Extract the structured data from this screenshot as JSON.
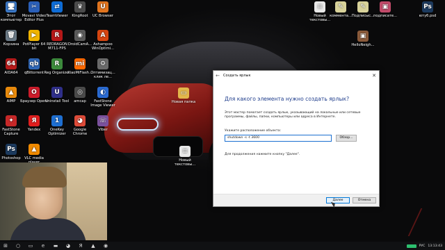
{
  "desktop": {
    "icons_left": [
      {
        "label": "Этот компьютер",
        "glyph": "🖥",
        "color": "#3a78c8",
        "icon": "computer-icon"
      },
      {
        "label": "Movavi Video Editor Plus",
        "glyph": "✂",
        "color": "#2a5fb8",
        "icon": "movavi-icon"
      },
      {
        "label": "TeamViewer",
        "glyph": "⇄",
        "color": "#0e6cd6",
        "icon": "teamviewer-icon"
      },
      {
        "label": "KingRoot",
        "glyph": "♛",
        "color": "#4b4b4b",
        "icon": "kingroot-icon"
      },
      {
        "label": "UC Browser",
        "glyph": "U",
        "color": "#e0741e",
        "icon": "uc-browser-icon"
      },
      {
        "label": "Корзина",
        "glyph": "🗑",
        "color": "#6b7a86",
        "icon": "recycle-bin-icon"
      },
      {
        "label": "PotPlayer 64 bit",
        "glyph": "▶",
        "color": "#f0b400",
        "icon": "potplayer-icon"
      },
      {
        "label": "REDRAGON M711-FPS",
        "glyph": "R",
        "color": "#b51818",
        "icon": "redragon-icon"
      },
      {
        "label": "DroidCamA...",
        "glyph": "◉",
        "color": "#5a5a5a",
        "icon": "droidcam-icon"
      },
      {
        "label": "Ashampoo WinOptimi...",
        "glyph": "A",
        "color": "#d64510",
        "icon": "ashampoo-icon"
      },
      {
        "label": "AIDA64",
        "glyph": "64",
        "color": "#b71b1b",
        "icon": "aida64-icon"
      },
      {
        "label": "qBittorrent",
        "glyph": "qb",
        "color": "#2f67b6",
        "icon": "qbittorrent-icon"
      },
      {
        "label": "Reg Organizer",
        "glyph": "R",
        "color": "#3c8a3c",
        "icon": "reg-organizer-icon"
      },
      {
        "label": "XiaoMiFlash...",
        "glyph": "mi",
        "color": "#ff6900",
        "icon": "xiaomi-flash-icon"
      },
      {
        "label": "Оптимизац... клик ле...",
        "glyph": "⚙",
        "color": "#6a6a6a",
        "icon": "optimizer-icon"
      },
      {
        "label": "AIMP",
        "glyph": "▲",
        "color": "#e88a0c",
        "icon": "aimp-icon"
      },
      {
        "label": "Браузер Opera",
        "glyph": "O",
        "color": "#cc1b2a",
        "icon": "opera-icon"
      },
      {
        "label": "Uninstall Tool",
        "glyph": "U",
        "color": "#2f2f8a",
        "icon": "uninstall-tool-icon"
      },
      {
        "label": "amcap",
        "glyph": "◎",
        "color": "#4a4a4a",
        "icon": "amcap-icon"
      },
      {
        "label": "FastStone Image Viewer",
        "glyph": "◐",
        "color": "#2a6ad0",
        "icon": "faststone-viewer-icon"
      },
      {
        "label": "FastStone Capture",
        "glyph": "✦",
        "color": "#c62828",
        "icon": "faststone-capture-icon"
      },
      {
        "label": "Yandex",
        "glyph": "Я",
        "color": "#e01e1e",
        "icon": "yandex-icon"
      },
      {
        "label": "OneKey Optimizer",
        "glyph": "1",
        "color": "#1e6fd1",
        "icon": "onekey-icon"
      },
      {
        "label": "Google Chrome",
        "glyph": "◕",
        "color": "#dd4b39",
        "icon": "chrome-icon"
      },
      {
        "label": "Viber",
        "glyph": "☏",
        "color": "#7b519d",
        "icon": "viber-icon"
      },
      {
        "label": "Photoshop",
        "glyph": "Ps",
        "color": "#1c3a5e",
        "icon": "photoshop-icon"
      },
      {
        "label": "VLC media player",
        "glyph": "▲",
        "color": "#f08a00",
        "icon": "vlc-icon"
      }
    ],
    "icons_right": [
      {
        "label": "Новый текстовы...",
        "glyph": "≡",
        "color": "#e8e8e8",
        "icon": "text-file-icon"
      },
      {
        "label": "коммента...",
        "glyph": "✎",
        "color": "#d8d29a",
        "icon": "document-icon"
      },
      {
        "label": "Подписыс...",
        "glyph": "✎",
        "color": "#d8d29a",
        "icon": "document-icon"
      },
      {
        "label": "подписате...",
        "glyph": "▣",
        "color": "#c24b6a",
        "icon": "image-file-icon"
      },
      {
        "label": "ютуб.psd",
        "glyph": "Ps",
        "color": "#1c3a5e",
        "icon": "psd-file-icon"
      },
      {
        "label": "HelloNeigh...",
        "glyph": "▣",
        "color": "#8a5a3a",
        "icon": "game-icon"
      },
      {
        "label": "Новая папка",
        "glyph": "▭",
        "color": "#e3b64b",
        "icon": "folder-icon"
      },
      {
        "label": "Новый текстовы...",
        "glyph": "≡",
        "color": "#e8e8e8",
        "icon": "text-file-icon"
      }
    ]
  },
  "dialog": {
    "title": "Создать ярлык",
    "heading": "Для какого элемента нужно создать ярлык?",
    "description": "Этот мастер помогает создать ярлык, указывающий на локальные или сетевые программы, файлы, папки, компьютеры или адреса в Интернете.",
    "location_label": "Укажите расположение объекта:",
    "location_value": "shutdown -s -t 3600",
    "browse_label": "Обзор...",
    "continue_text": "Для продолжения нажмите кнопку \"Далее\".",
    "next_label": "Далее",
    "cancel_label": "Отмена",
    "back_glyph": "←",
    "close_glyph": "✕"
  },
  "taskbar": {
    "icons": [
      {
        "glyph": "⊞",
        "name": "start-icon"
      },
      {
        "glyph": "○",
        "name": "search-icon"
      },
      {
        "glyph": "▭",
        "name": "task-view-icon"
      },
      {
        "glyph": "e",
        "name": "edge-icon"
      },
      {
        "glyph": "▬",
        "name": "explorer-icon"
      },
      {
        "glyph": "◕",
        "name": "chrome-taskbar-icon"
      },
      {
        "glyph": "Я",
        "name": "yandex-taskbar-icon"
      },
      {
        "glyph": "▲",
        "name": "aimp-taskbar-icon"
      },
      {
        "glyph": "◉",
        "name": "camera-taskbar-icon"
      }
    ],
    "language": "РУС",
    "time": "13:13:43",
    "date": "..."
  }
}
